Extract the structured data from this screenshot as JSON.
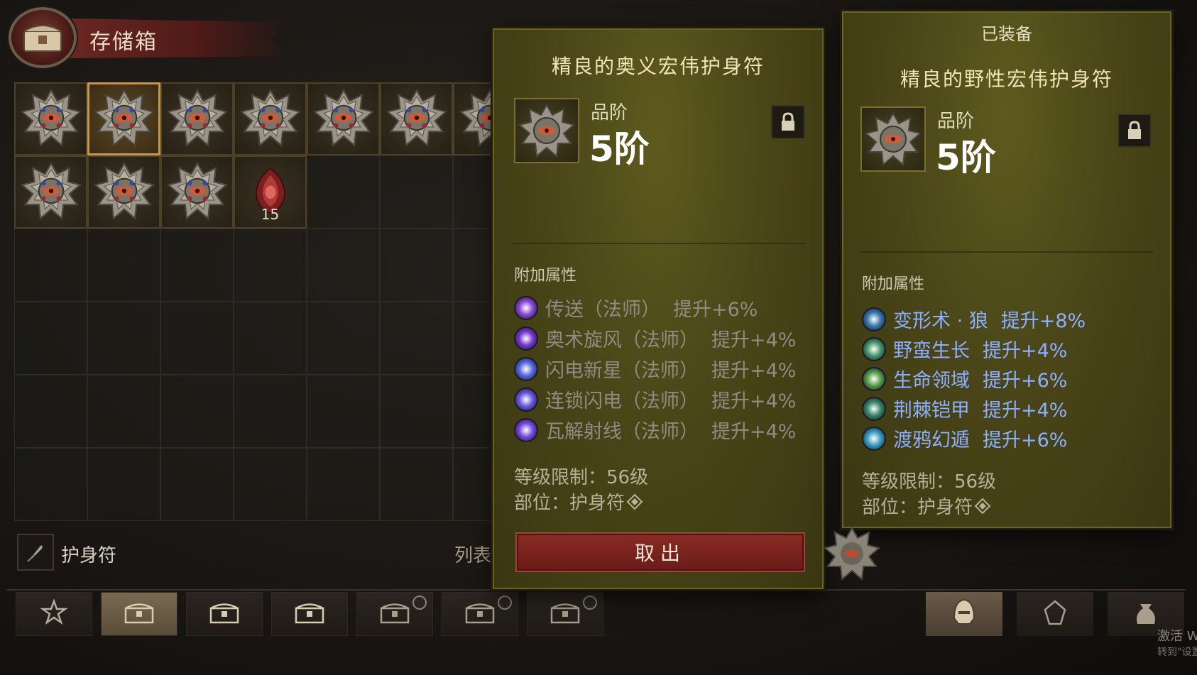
{
  "header": {
    "title": "存储箱",
    "icon": "chest-icon"
  },
  "grid": {
    "rows": 6,
    "cols": 7,
    "items": [
      {
        "icon": "amulet-icon",
        "selected": false
      },
      {
        "icon": "amulet-icon",
        "selected": true
      },
      {
        "icon": "amulet-icon",
        "selected": false
      },
      {
        "icon": "amulet-icon",
        "selected": false
      },
      {
        "icon": "amulet-icon",
        "selected": false
      },
      {
        "icon": "amulet-icon",
        "selected": false
      },
      {
        "icon": "amulet-icon",
        "selected": false
      },
      {
        "icon": "amulet-icon",
        "selected": false
      },
      {
        "icon": "amulet-icon",
        "selected": false
      },
      {
        "icon": "amulet-icon",
        "selected": false
      },
      {
        "icon": "red-consumable-icon",
        "quantity": "15"
      }
    ]
  },
  "filter": {
    "label": "护身符",
    "icon": "feather-icon"
  },
  "list_label": "列表",
  "tabs": [
    {
      "icon": "star-icon",
      "active": false
    },
    {
      "icon": "chest-icon",
      "active": true
    },
    {
      "icon": "chest-icon",
      "active": false
    },
    {
      "icon": "chest-icon",
      "active": false
    },
    {
      "icon": "locked-chest-icon",
      "active": false
    },
    {
      "icon": "locked-chest-icon",
      "active": false
    },
    {
      "icon": "locked-chest-icon",
      "active": false
    }
  ],
  "right_tabs": [
    {
      "icon": "helmet-icon",
      "active": true
    },
    {
      "icon": "gem-icon",
      "active": false
    },
    {
      "icon": "bag-icon",
      "active": false
    }
  ],
  "tooltip_selected": {
    "name": "精良的奥义宏伟护身符",
    "tier_label": "品阶",
    "tier": "5阶",
    "affix_header": "附加属性",
    "affixes": [
      {
        "skill": "传送（法师）",
        "bonus": "提升+6%",
        "icon_color": "#8a4ad8"
      },
      {
        "skill": "奥术旋风（法师）",
        "bonus": "提升+4%",
        "icon_color": "#7a3ad0"
      },
      {
        "skill": "闪电新星（法师）",
        "bonus": "提升+4%",
        "icon_color": "#5a6ae0"
      },
      {
        "skill": "连锁闪电（法师）",
        "bonus": "提升+4%",
        "icon_color": "#6a5ae0"
      },
      {
        "skill": "瓦解射线（法师）",
        "bonus": "提升+4%",
        "icon_color": "#7a4ae0"
      }
    ],
    "level_req": "等级限制：56级",
    "slot": "部位：护身符",
    "takeout_label": "取出"
  },
  "tooltip_equipped": {
    "equipped_label": "已装备",
    "name": "精良的野性宏伟护身符",
    "tier_label": "品阶",
    "tier": "5阶",
    "affix_header": "附加属性",
    "affixes": [
      {
        "skill": "变形术 · 狼",
        "bonus": "提升+8%",
        "icon_color": "#3a7ab0"
      },
      {
        "skill": "野蛮生长",
        "bonus": "提升+4%",
        "icon_color": "#4a9a6a"
      },
      {
        "skill": "生命领域",
        "bonus": "提升+6%",
        "icon_color": "#5aa04a"
      },
      {
        "skill": "荆棘铠甲",
        "bonus": "提升+4%",
        "icon_color": "#3a8a6a"
      },
      {
        "skill": "渡鸦幻遁",
        "bonus": "提升+6%",
        "icon_color": "#3aa0c0"
      }
    ],
    "level_req": "等级限制：56级",
    "slot": "部位：护身符"
  },
  "watermark": {
    "line1": "激活 W",
    "line2": "转到\"设置"
  },
  "colors": {
    "inactive_affix": "#8e8c84",
    "active_affix": "#8cb0ff",
    "tooltip_bg": "#4a4618",
    "takeout_button": "#7a2420"
  }
}
